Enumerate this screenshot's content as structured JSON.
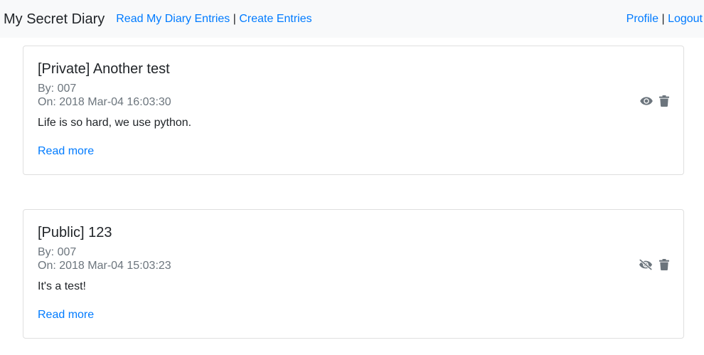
{
  "navbar": {
    "brand": "My Secret Diary",
    "separator": "|",
    "links": [
      {
        "label": "Read My Diary Entries"
      },
      {
        "label": "Create Entries"
      }
    ],
    "right_links": [
      {
        "label": "Profile"
      },
      {
        "label": "Logout"
      }
    ]
  },
  "entries": [
    {
      "title": "[Private] Another test",
      "by": "By: 007",
      "on": "On: 2018 Mar-04 16:03:30",
      "body": "Life is so hard, we use python.",
      "read_more": "Read more",
      "icons": {
        "toggle": "eye-icon",
        "delete": "trash-icon"
      }
    },
    {
      "title": "[Public] 123",
      "by": "By: 007",
      "on": "On: 2018 Mar-04 15:03:23",
      "body": "It's a test!",
      "read_more": "Read more",
      "icons": {
        "toggle": "eye-slash-icon",
        "delete": "trash-icon"
      }
    }
  ],
  "colors": {
    "link": "#007bff",
    "text": "#212529",
    "muted": "#6c757d",
    "navbar_bg": "#f8f9fa",
    "card_border": "#dfdfdf",
    "icon": "#6c757d"
  }
}
